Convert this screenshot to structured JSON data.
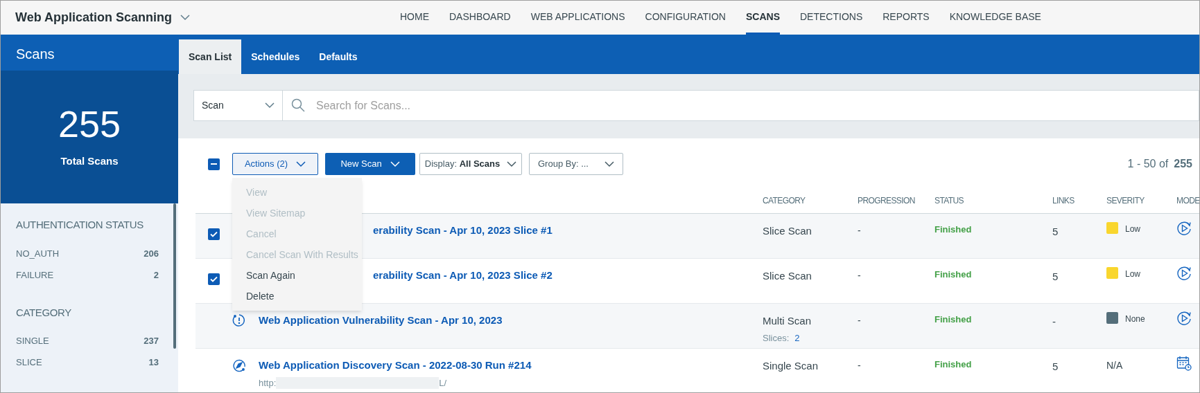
{
  "app": {
    "title": "Web Application Scanning"
  },
  "nav": [
    {
      "label": "HOME",
      "selected": false
    },
    {
      "label": "DASHBOARD",
      "selected": false
    },
    {
      "label": "WEB APPLICATIONS",
      "selected": false
    },
    {
      "label": "CONFIGURATION",
      "selected": false
    },
    {
      "label": "SCANS",
      "selected": true
    },
    {
      "label": "DETECTIONS",
      "selected": false
    },
    {
      "label": "REPORTS",
      "selected": false
    },
    {
      "label": "KNOWLEDGE BASE",
      "selected": false
    }
  ],
  "section_title": "Scans",
  "tabs": [
    {
      "label": "Scan List",
      "selected": true
    },
    {
      "label": "Schedules",
      "selected": false
    },
    {
      "label": "Defaults",
      "selected": false
    }
  ],
  "summary": {
    "count": "255",
    "label": "Total Scans"
  },
  "filters": [
    {
      "heading": "AUTHENTICATION STATUS",
      "items": [
        {
          "label": "NO_AUTH",
          "count": "206"
        },
        {
          "label": "FAILURE",
          "count": "2"
        }
      ]
    },
    {
      "heading": "CATEGORY",
      "items": [
        {
          "label": "SINGLE",
          "count": "237"
        },
        {
          "label": "SLICE",
          "count": "13"
        }
      ]
    }
  ],
  "search": {
    "scope": "Scan",
    "placeholder": "Search for Scans..."
  },
  "toolbar": {
    "select_all_partial": true,
    "actions": "Actions (2)",
    "new_scan": "New Scan",
    "display_label": "Display:",
    "display_value": "All Scans",
    "group_by": "Group By: ..."
  },
  "actions_menu": [
    {
      "label": "View",
      "disabled": true
    },
    {
      "label": "View Sitemap",
      "disabled": true
    },
    {
      "label": "Cancel",
      "disabled": true
    },
    {
      "label": "Cancel Scan With Results",
      "disabled": true
    },
    {
      "label": "Scan Again",
      "disabled": false
    },
    {
      "label": "Delete",
      "disabled": false
    }
  ],
  "pagination": {
    "range": "1 - 50 of",
    "total": "255"
  },
  "columns": [
    "CATEGORY",
    "PROGRESSION",
    "STATUS",
    "LINKS",
    "SEVERITY",
    "MODE"
  ],
  "rows": [
    {
      "kind": "slice",
      "selected": true,
      "covered": true,
      "title": "erability Scan - Apr 10, 2023 Slice #1",
      "category": "Slice Scan",
      "progression": "-",
      "status": "Finished",
      "links": "5",
      "severity": {
        "label": "Low",
        "color": "#f9d62e"
      }
    },
    {
      "kind": "slice",
      "selected": true,
      "covered": true,
      "title": "erability Scan - Apr 10, 2023 Slice #2",
      "category": "Slice Scan",
      "progression": "-",
      "status": "Finished",
      "links": "5",
      "severity": {
        "label": "Low",
        "color": "#f9d62e"
      }
    },
    {
      "kind": "multi",
      "selected": false,
      "covered": false,
      "title": "Web Application Vulnerability Scan - Apr 10, 2023",
      "category": "Multi Scan",
      "slices_label": "Slices:",
      "slices": "2",
      "progression": "-",
      "status": "Finished",
      "links": "-",
      "severity": {
        "label": "None",
        "color": "#546e7a"
      }
    },
    {
      "kind": "discovery",
      "selected": false,
      "covered": false,
      "title": "Web Application Discovery Scan - 2022-08-30 Run #214",
      "url_start": "http:",
      "url_end": "L/",
      "category": "Single Scan",
      "progression": "-",
      "status": "Finished",
      "links": "5",
      "severity": {
        "label": "N/A"
      }
    }
  ]
}
